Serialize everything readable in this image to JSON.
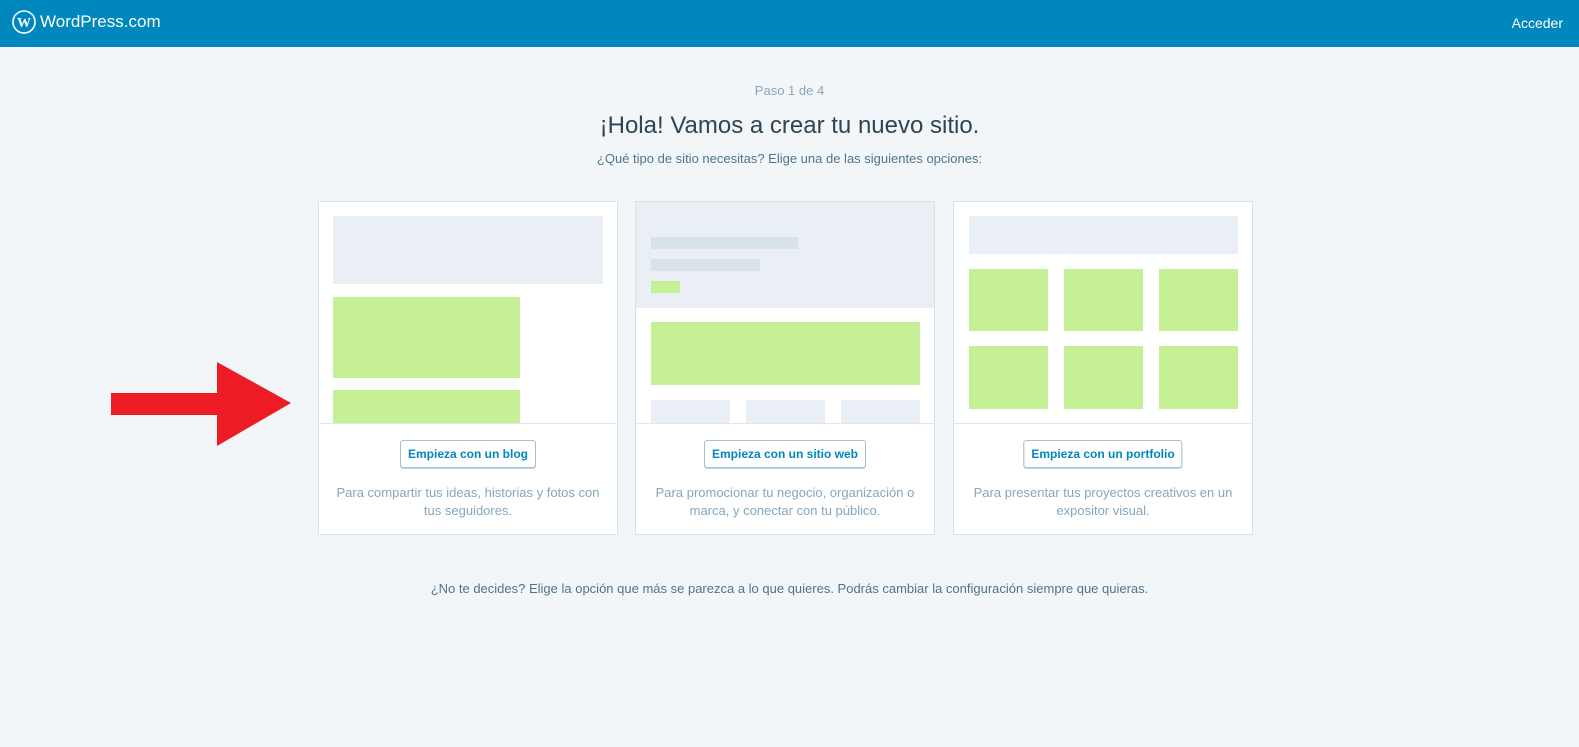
{
  "header": {
    "brand": "WordPress.com",
    "login": "Acceder"
  },
  "step": "Paso 1 de 4",
  "title": "¡Hola! Vamos a crear tu nuevo sitio.",
  "subtitle": "¿Qué tipo de sitio necesitas? Elige una de las siguientes opciones:",
  "cards": [
    {
      "button": "Empieza con un blog",
      "description": "Para compartir tus ideas, historias y fotos con tus seguidores."
    },
    {
      "button": "Empieza con un sitio web",
      "description": "Para promocionar tu negocio, organización o marca, y conectar con tu público."
    },
    {
      "button": "Empieza con un portfolio",
      "description": "Para presentar tus proyectos creativos en un expositor visual."
    }
  ],
  "footnote": "¿No te decides? Elige la opción que más se parezca a lo que quieres. Podrás cambiar la configuración siempre que quieras.",
  "colors": {
    "header_bg": "#0087be",
    "page_bg": "#f3f6f8",
    "illustration_green": "#c5f096",
    "annotation_arrow": "#ed1c24"
  },
  "annotation": {
    "icon": "red-arrow-right-icon"
  }
}
